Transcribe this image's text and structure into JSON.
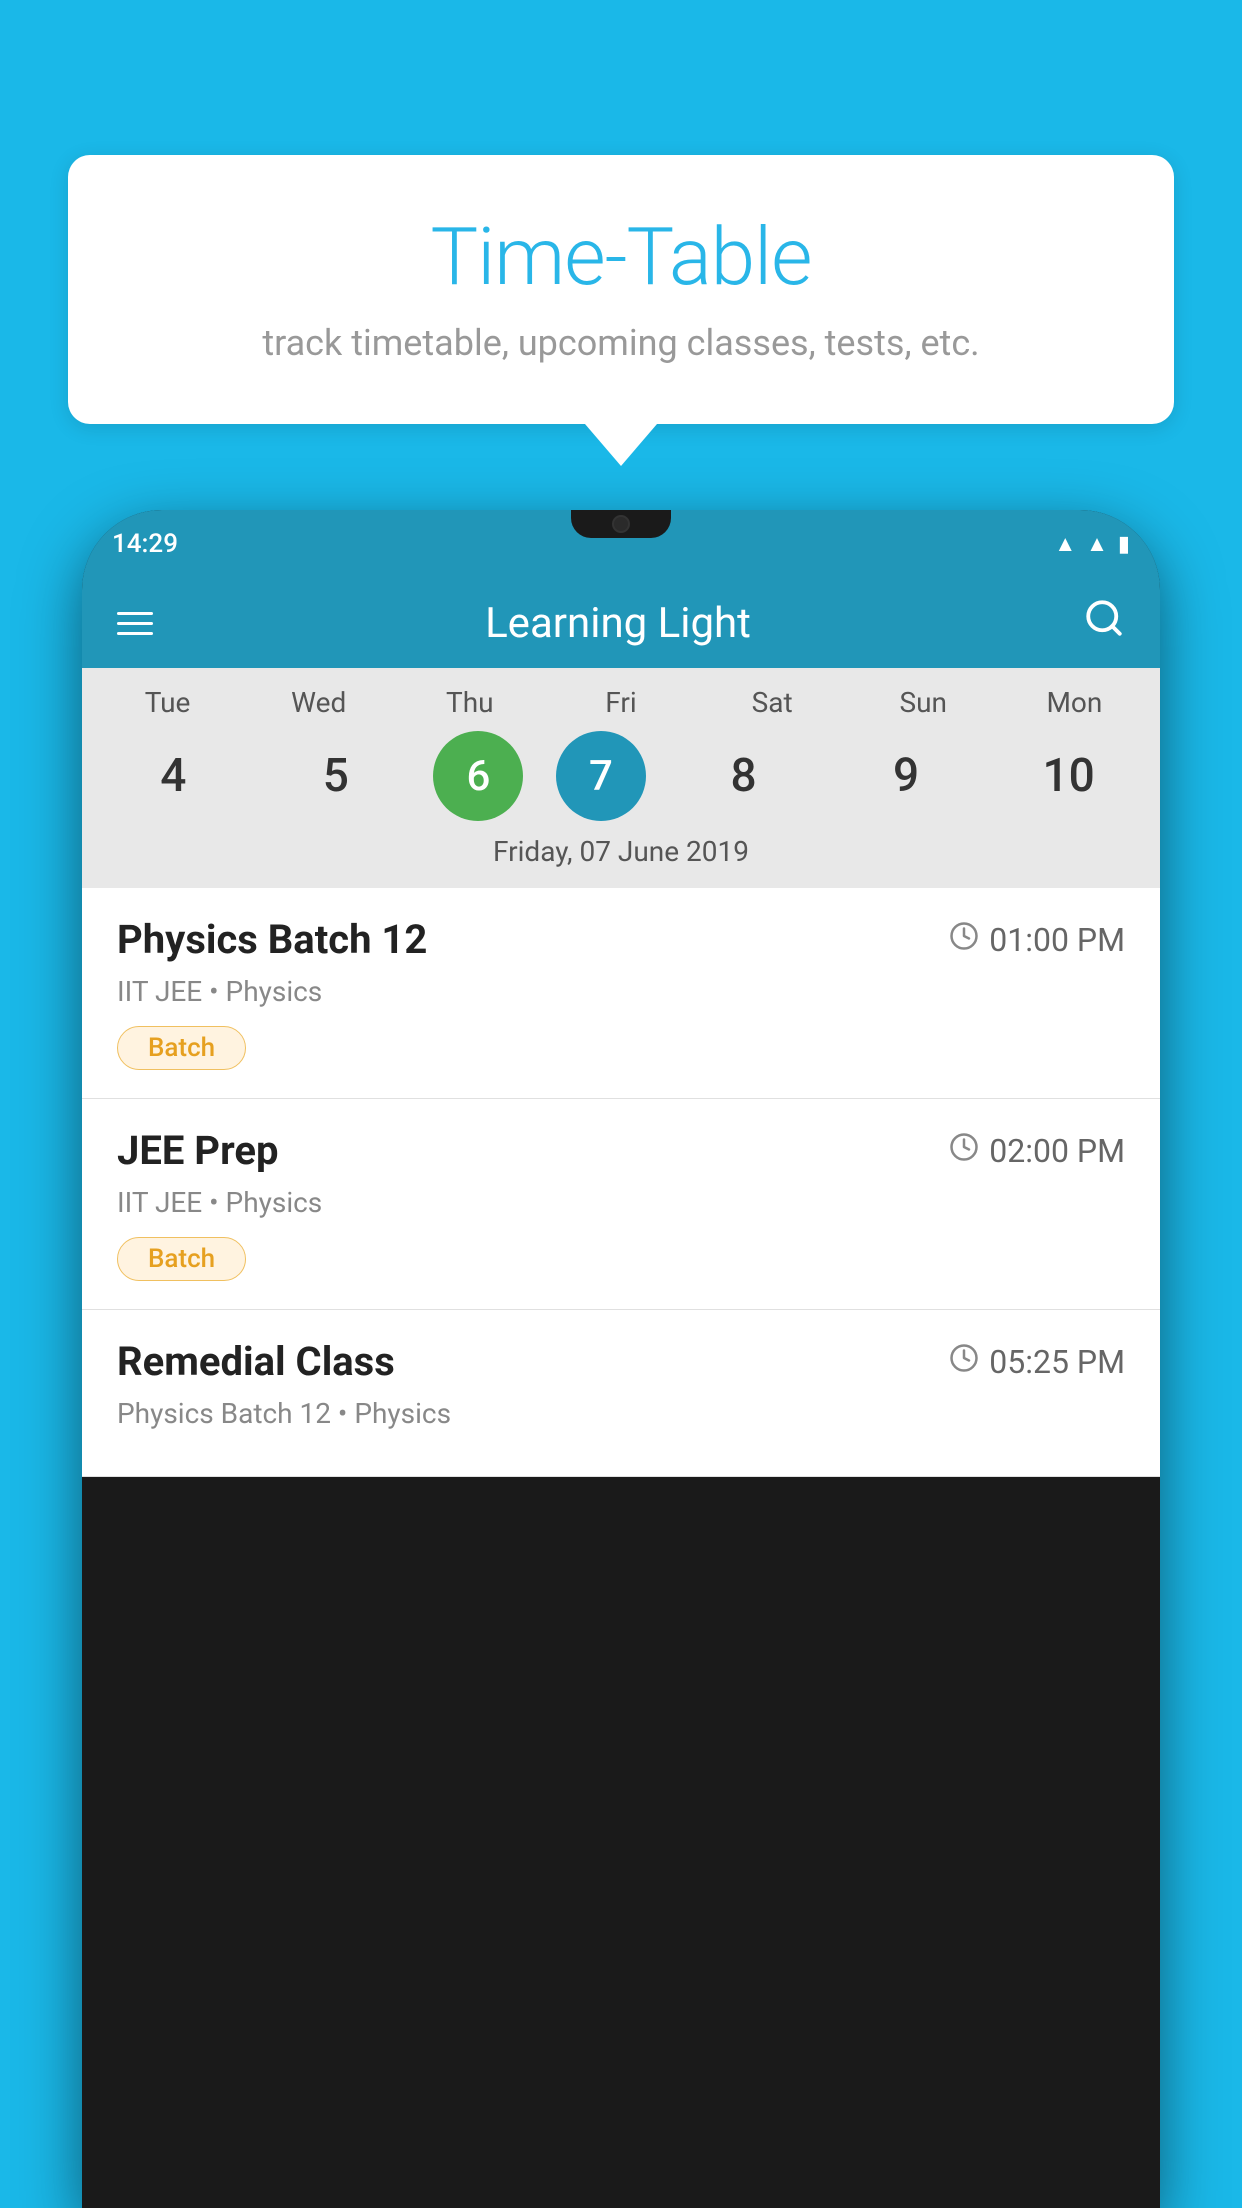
{
  "background_color": "#1ab8e8",
  "speech_bubble": {
    "title": "Time-Table",
    "subtitle": "track timetable, upcoming classes, tests, etc."
  },
  "phone": {
    "status_bar": {
      "time": "14:29"
    },
    "app_header": {
      "title": "Learning Light"
    },
    "calendar": {
      "days": [
        {
          "short": "Tue",
          "num": "4"
        },
        {
          "short": "Wed",
          "num": "5"
        },
        {
          "short": "Thu",
          "num": "6",
          "state": "today"
        },
        {
          "short": "Fri",
          "num": "7",
          "state": "selected"
        },
        {
          "short": "Sat",
          "num": "8"
        },
        {
          "short": "Sun",
          "num": "9"
        },
        {
          "short": "Mon",
          "num": "10"
        }
      ],
      "selected_date_label": "Friday, 07 June 2019"
    },
    "classes": [
      {
        "name": "Physics Batch 12",
        "time": "01:00 PM",
        "meta": "IIT JEE • Physics",
        "badge": "Batch"
      },
      {
        "name": "JEE Prep",
        "time": "02:00 PM",
        "meta": "IIT JEE • Physics",
        "badge": "Batch"
      },
      {
        "name": "Remedial Class",
        "time": "05:25 PM",
        "meta": "Physics Batch 12 • Physics",
        "badge": ""
      }
    ]
  }
}
